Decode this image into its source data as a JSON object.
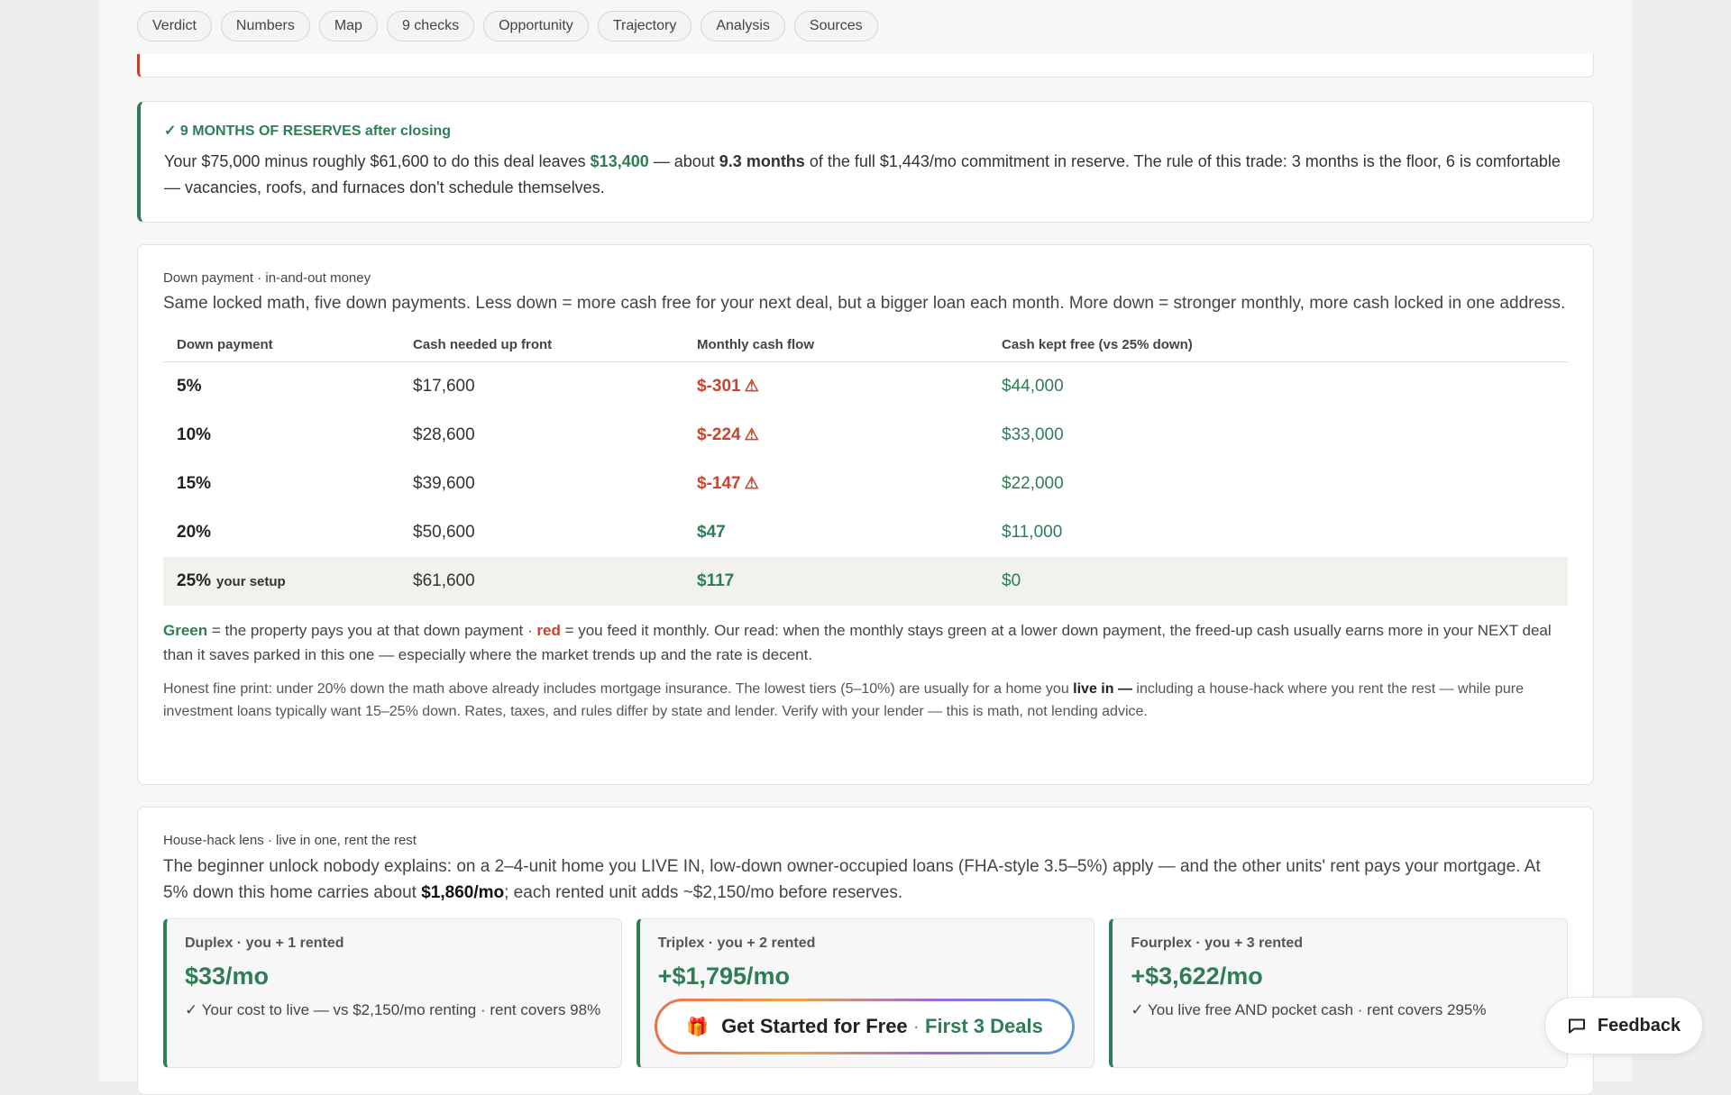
{
  "nav": {
    "chips": [
      "Verdict",
      "Numbers",
      "Map",
      "9 checks",
      "Opportunity",
      "Trajectory",
      "Analysis",
      "Sources"
    ]
  },
  "reserve": {
    "title": "✓ 9 MONTHS OF RESERVES after closing",
    "text_1": "Your $75,000 minus roughly $61,600 to do this deal leaves ",
    "amount": "$13,400",
    "text_2": " — about ",
    "months": "9.3 months",
    "text_3": " of the full $1,443/mo commitment in reserve. The rule of this trade: 3 months is the floor, 6 is comfortable — vacancies, roofs, and furnaces don't schedule themselves."
  },
  "down_payment": {
    "eyebrow": "Down payment · in-and-out money",
    "lead": "Same locked math, five down payments. Less down = more cash free for your next deal, but a bigger loan each month. More down = stronger monthly, more cash locked in one address.",
    "headers": [
      "Down payment",
      "Cash needed up front",
      "Monthly cash flow",
      "Cash kept free (vs 25% down)"
    ],
    "rows": [
      {
        "pct": "5%",
        "tag": "",
        "cash": "$17,600",
        "flow": "$-301",
        "warn": "⚠",
        "free": "$44,000"
      },
      {
        "pct": "10%",
        "tag": "",
        "cash": "$28,600",
        "flow": "$-224",
        "warn": "⚠",
        "free": "$33,000"
      },
      {
        "pct": "15%",
        "tag": "",
        "cash": "$39,600",
        "flow": "$-147",
        "warn": "⚠",
        "free": "$22,000"
      },
      {
        "pct": "20%",
        "tag": "",
        "cash": "$50,600",
        "flow": "$47",
        "warn": "",
        "free": "$11,000"
      },
      {
        "pct": "25%",
        "tag": "your setup",
        "cash": "$61,600",
        "flow": "$117",
        "warn": "",
        "free": "$0"
      }
    ],
    "legend_green": "Green",
    "legend_1": " = the property pays you at that down payment · ",
    "legend_red": "red",
    "legend_2": " = you feed it monthly. Our read: when the monthly stays green at a lower down payment, the freed-up cash usually earns more in your NEXT deal than it saves parked in this one — especially where the market trends up and the rate is decent.",
    "fine_1": "Honest fine print: under 20% down the math above already includes mortgage insurance. The lowest tiers (5–10%) are usually for a home you ",
    "fine_bold": "live in —",
    "fine_2": " including a house-hack where you rent the rest — while pure investment loans typically want 15–25% down. Rates, taxes, and rules differ by state and lender. Verify with your lender — this is math, not lending advice."
  },
  "house_hack": {
    "eyebrow": "House-hack lens · live in one, rent the rest",
    "lead_1": "The beginner unlock nobody explains: on a 2–4-unit home you LIVE IN, low-down owner-occupied loans (FHA-style 3.5–5%) apply — and the other units' rent pays your mortgage. At 5% down this home carries about ",
    "lead_bold": "$1,860/mo",
    "lead_2": "; each rented unit adds ~$2,150/mo before reserves.",
    "units": [
      {
        "title": "Duplex · you + 1 rented",
        "value": "$33/mo",
        "desc": "✓ Your cost to live — vs $2,150/mo renting · rent covers 98%"
      },
      {
        "title": "Triplex · you + 2 rented",
        "value": "+$1,795/mo",
        "desc": ""
      },
      {
        "title": "Fourplex · you + 3 rented",
        "value": "+$3,622/mo",
        "desc": "✓ You live free AND pocket cash · rent covers 295%"
      }
    ]
  },
  "cta": {
    "main": "Get Started for Free",
    "sep": "·",
    "sub": "First 3 Deals",
    "icon": "gift-icon"
  },
  "feedback": {
    "label": "Feedback",
    "icon": "chat-bubble-icon"
  },
  "colors": {
    "green": "#2f7d55",
    "red": "#c5452f"
  }
}
